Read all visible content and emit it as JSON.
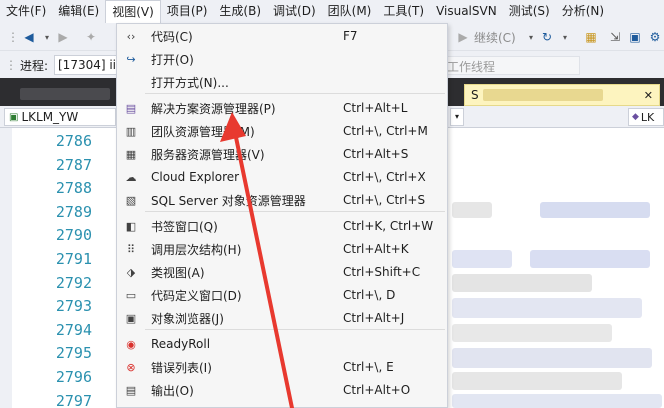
{
  "menubar": {
    "items": [
      {
        "label": "文件(F)"
      },
      {
        "label": "编辑(E)"
      },
      {
        "label": "视图(V)"
      },
      {
        "label": "项目(P)"
      },
      {
        "label": "生成(B)"
      },
      {
        "label": "调试(D)"
      },
      {
        "label": "团队(M)"
      },
      {
        "label": "工具(T)"
      },
      {
        "label": "VisualSVN"
      },
      {
        "label": "测试(S)"
      },
      {
        "label": "分析(N)"
      }
    ]
  },
  "toolbar": {
    "continue_label": "继续(C)"
  },
  "process": {
    "label": "进程:",
    "value": "[17304] iis",
    "thread_placeholder": "工作线程"
  },
  "navbar": {
    "left_combo": "LKLM_YW",
    "right_combo": "LK"
  },
  "doc_tab": {
    "label": "S"
  },
  "editor": {
    "line_numbers": [
      "2786",
      "2787",
      "2788",
      "2789",
      "2790",
      "2791",
      "2792",
      "2793",
      "2794",
      "2795",
      "2796",
      "2797"
    ]
  },
  "view_menu": {
    "items": [
      {
        "label": "代码(C)",
        "shortcut": "F7",
        "icon": "code-icon"
      },
      {
        "label": "打开(O)",
        "shortcut": "",
        "icon": "open-icon"
      },
      {
        "label": "打开方式(N)...",
        "shortcut": "",
        "icon": ""
      },
      {
        "label": "解决方案资源管理器(P)",
        "shortcut": "Ctrl+Alt+L",
        "icon": "solution-explorer-icon"
      },
      {
        "label": "团队资源管理器(M)",
        "shortcut": "Ctrl+\\, Ctrl+M",
        "icon": "team-explorer-icon"
      },
      {
        "label": "服务器资源管理器(V)",
        "shortcut": "Ctrl+Alt+S",
        "icon": "server-explorer-icon"
      },
      {
        "label": "Cloud Explorer",
        "shortcut": "Ctrl+\\, Ctrl+X",
        "icon": "cloud-icon"
      },
      {
        "label": "SQL Server 对象资源管理器",
        "shortcut": "Ctrl+\\, Ctrl+S",
        "icon": "sql-server-icon"
      },
      {
        "label": "书签窗口(Q)",
        "shortcut": "Ctrl+K, Ctrl+W",
        "icon": "bookmark-icon"
      },
      {
        "label": "调用层次结构(H)",
        "shortcut": "Ctrl+Alt+K",
        "icon": "call-hierarchy-icon"
      },
      {
        "label": "类视图(A)",
        "shortcut": "Ctrl+Shift+C",
        "icon": "class-view-icon"
      },
      {
        "label": "代码定义窗口(D)",
        "shortcut": "Ctrl+\\, D",
        "icon": "code-definition-icon"
      },
      {
        "label": "对象浏览器(J)",
        "shortcut": "Ctrl+Alt+J",
        "icon": "object-browser-icon"
      },
      {
        "label": "ReadyRoll",
        "shortcut": "",
        "icon": "readyroll-icon"
      },
      {
        "label": "错误列表(I)",
        "shortcut": "Ctrl+\\, E",
        "icon": "error-list-icon"
      },
      {
        "label": "输出(O)",
        "shortcut": "Ctrl+Alt+O",
        "icon": "output-icon"
      }
    ]
  },
  "colors": {
    "menu_bg": "#f6f6f6",
    "line_number": "#2b91af",
    "arrow": "#e8392f",
    "tab_strip": "#2d2d30"
  }
}
